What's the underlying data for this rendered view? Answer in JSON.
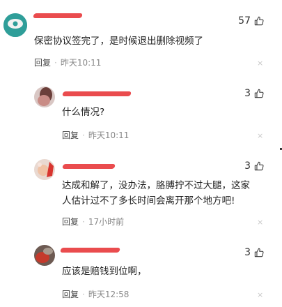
{
  "comments": [
    {
      "text": "保密协议签完了，是时候退出删除视频了",
      "reply_label": "回复",
      "time": "昨天10:11",
      "likes": "57",
      "close": "×"
    },
    {
      "text": "什么情况?",
      "reply_label": "回复",
      "time": "昨天10:11",
      "likes": "3",
      "close": "×"
    },
    {
      "text_line1": "达成和解了，没办法，胳膊拧不过大腿，这家",
      "text_line2": "人估计过不了多长时间会离开那个地方吧!",
      "reply_label": "回复",
      "time": "17小时前",
      "likes": "3",
      "close": "×"
    },
    {
      "text": "应该是赔钱到位啊，",
      "reply_label": "回复",
      "time": "昨天12:58",
      "likes": "3",
      "close": "×"
    }
  ],
  "separator": "·",
  "icons": {
    "like": "thumbs-up-icon",
    "close": "close-icon"
  },
  "colors": {
    "redaction": "#e8383b"
  }
}
